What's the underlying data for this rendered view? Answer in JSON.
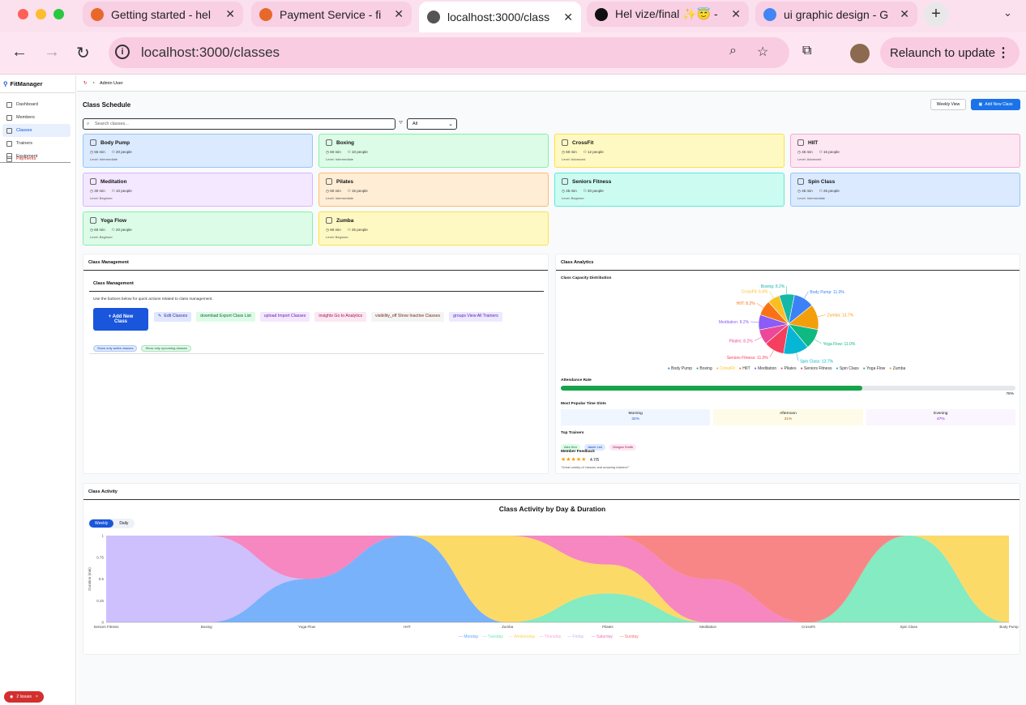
{
  "browser": {
    "tabs": [
      {
        "title": "Getting started - hel",
        "fav_color": "#e8682a"
      },
      {
        "title": "Payment Service - fi",
        "fav_color": "#e8682a"
      },
      {
        "title": "localhost:3000/class",
        "fav_color": "#555555"
      },
      {
        "title": "Hel vize/final ✨😇 -",
        "fav_color": "#111111"
      },
      {
        "title": "ui graphic design - G",
        "fav_color": "#4285f4"
      }
    ],
    "url": "localhost:3000/classes",
    "relaunch_label": "Relaunch to update"
  },
  "sidebar": {
    "brand": "FitManager",
    "items": [
      {
        "label": "Dashboard"
      },
      {
        "label": "Members"
      },
      {
        "label": "Classes"
      },
      {
        "label": "Trainers"
      },
      {
        "label": "Equipment"
      },
      {
        "label": "Payments"
      }
    ]
  },
  "topbar": {
    "user": "Admin User"
  },
  "schedule": {
    "title": "Class Schedule",
    "weekly_view": "Weekly View",
    "add_class": "Add New Class",
    "search_placeholder": "Search classes...",
    "filter_value": "All",
    "classes": [
      {
        "name": "Body Pump",
        "duration": "55 min",
        "capacity": "20 people",
        "level": "Level: Intermediate",
        "bg": "#dbeafe",
        "border": "#93c5fd"
      },
      {
        "name": "Boxing",
        "duration": "60 min",
        "capacity": "10 people",
        "level": "Level: Intermediate",
        "bg": "#dcfce7",
        "border": "#86efac"
      },
      {
        "name": "CrossFit",
        "duration": "60 min",
        "capacity": "12 people",
        "level": "Level: Advanced",
        "bg": "#fef9c3",
        "border": "#fde047"
      },
      {
        "name": "HIIT",
        "duration": "45 min",
        "capacity": "15 people",
        "level": "Level: Advanced",
        "bg": "#fce7f3",
        "border": "#f9a8d4"
      },
      {
        "name": "Meditation",
        "duration": "30 min",
        "capacity": "10 people",
        "level": "Level: Beginner",
        "bg": "#f3e8ff",
        "border": "#d8b4fe"
      },
      {
        "name": "Pilates",
        "duration": "50 min",
        "capacity": "15 people",
        "level": "Level: Intermediate",
        "bg": "#ffedd5",
        "border": "#fdba74"
      },
      {
        "name": "Seniors Fitness",
        "duration": "45 min",
        "capacity": "20 people",
        "level": "Level: Beginner",
        "bg": "#ccfbf1",
        "border": "#5eead4"
      },
      {
        "name": "Spin Class",
        "duration": "45 min",
        "capacity": "25 people",
        "level": "Level: Intermediate",
        "bg": "#dbeafe",
        "border": "#93c5fd"
      },
      {
        "name": "Yoga Flow",
        "duration": "60 min",
        "capacity": "20 people",
        "level": "Level: Beginner",
        "bg": "#dcfce7",
        "border": "#86efac"
      },
      {
        "name": "Zumba",
        "duration": "60 min",
        "capacity": "25 people",
        "level": "Level: Beginner",
        "bg": "#fef9c3",
        "border": "#fde047"
      }
    ]
  },
  "management": {
    "title": "Class Management",
    "inner_title": "Class Management",
    "description": "Use the buttons below for quick actions related to class management.",
    "add_label": "+ Add New Class",
    "actions": [
      {
        "label": "Edit Classes",
        "icon": "edit-icon",
        "bg": "#e0e7ff",
        "color": "#3730a3"
      },
      {
        "label": "download  Export Class List",
        "icon": "",
        "bg": "#dcfce7",
        "color": "#166534"
      },
      {
        "label": "upload  Import Classes",
        "icon": "",
        "bg": "#f3e8ff",
        "color": "#6b21a8"
      },
      {
        "label": "insights  Go to Analytics",
        "icon": "",
        "bg": "#fce7f3",
        "color": "#9d174d"
      },
      {
        "label": "visibility_off  Show Inactive Classes",
        "icon": "",
        "bg": "#f3f4f6",
        "color": "#7c2d12"
      },
      {
        "label": "groups  View All Trainers",
        "icon": "",
        "bg": "#ede9fe",
        "color": "#5b21b6"
      }
    ],
    "pills": [
      {
        "label": "Show only active classes",
        "bg": "#dbeafe",
        "color": "#1e40af"
      },
      {
        "label": "Show only upcoming classes",
        "bg": "#dcfce7",
        "color": "#166534"
      }
    ]
  },
  "analytics": {
    "title": "Class Analytics",
    "pie_title": "Class Capacity Distribution",
    "attendance_label": "Attendance Rate",
    "attendance_value": 0.78,
    "attendance_text": "78%",
    "timeslots_title": "Most Popular Time Slots",
    "timeslots": [
      {
        "label": "Morning",
        "value": "32%",
        "bg": "#eff6ff",
        "color": "#1d4ed8"
      },
      {
        "label": "Afternoon",
        "value": "21%",
        "bg": "#fefce8",
        "color": "#a16207"
      },
      {
        "label": "Evening",
        "value": "47%",
        "bg": "#faf5ff",
        "color": "#7e22ce"
      }
    ],
    "trainers_title": "Top Trainers",
    "trainers": [
      {
        "name": "Alex Kim",
        "bg": "#dcfce7",
        "color": "#166534"
      },
      {
        "name": "Jamie Lee",
        "bg": "#dbeafe",
        "color": "#1e40af"
      },
      {
        "name": "Morgan Smith",
        "bg": "#fce7f3",
        "color": "#9d174d"
      }
    ],
    "feedback_title": "Member Feedback",
    "stars": "★★★★★",
    "rating": "4.7/5",
    "quote": "\"Great variety of classes and amazing trainers!\""
  },
  "activity": {
    "title": "Class Activity",
    "toggle": [
      "Weekly",
      "Daily"
    ]
  },
  "chart_data": [
    {
      "type": "pie",
      "title": "Class Capacity Distribution",
      "slices": [
        {
          "label": "Body Pump",
          "value": 11.0,
          "text": "Body Pump: 11.0%",
          "color": "#3b82f6"
        },
        {
          "label": "Zumba",
          "value": 13.7,
          "text": "Zumba: 13.7%",
          "color": "#f59e0b"
        },
        {
          "label": "Yoga Flow",
          "value": 11.0,
          "text": "Yoga Flow: 11.0%",
          "color": "#10b981"
        },
        {
          "label": "Spin Class",
          "value": 13.7,
          "text": "Spin Class: 13.7%",
          "color": "#06b6d4"
        },
        {
          "label": "Seniors Fitness",
          "value": 11.0,
          "text": "Seniors Fitness: 11.0%",
          "color": "#f43f5e"
        },
        {
          "label": "Pilates",
          "value": 8.2,
          "text": "Pilates: 8.2%",
          "color": "#ec4899"
        },
        {
          "label": "Meditation",
          "value": 8.2,
          "text": "Meditation: 8.2%",
          "color": "#8b5cf6"
        },
        {
          "label": "HIIT",
          "value": 8.2,
          "text": "HIIT: 8.2%",
          "color": "#f97316"
        },
        {
          "label": "CrossFit",
          "value": 6.6,
          "text": "CrossFit: 6.6%",
          "color": "#fbbf24"
        },
        {
          "label": "Boxing",
          "value": 8.2,
          "text": "Boxing: 8.2%",
          "color": "#14b8a6"
        }
      ],
      "legend": [
        {
          "label": "Body Pump",
          "color": "#3b82f6"
        },
        {
          "label": "Boxing",
          "color": "#10b981"
        },
        {
          "label": "CrossFit",
          "color": "#fbbf24"
        },
        {
          "label": "HIIT",
          "color": "#f97316"
        },
        {
          "label": "Meditation",
          "color": "#8b5cf6"
        },
        {
          "label": "Pilates",
          "color": "#ec4899"
        },
        {
          "label": "Seniors Fitness",
          "color": "#f43f5e"
        },
        {
          "label": "Spin Class",
          "color": "#06b6d4"
        },
        {
          "label": "Yoga Flow",
          "color": "#10b981"
        },
        {
          "label": "Zumba",
          "color": "#f59e0b"
        }
      ]
    },
    {
      "type": "area",
      "title": "Class Activity by Day & Duration",
      "ylabel": "Duration (min)",
      "ylim": [
        0,
        1
      ],
      "yticks": [
        "0",
        "0.25",
        "0.5",
        "0.75",
        "1"
      ],
      "categories": [
        "Seniors Fitness",
        "Boxing",
        "Yoga Flow",
        "HIIT",
        "Zumba",
        "Pilates",
        "Meditation",
        "CrossFit",
        "Spin Class",
        "Body Pump"
      ],
      "series": [
        {
          "name": "Monday",
          "color": "#60a5fa",
          "values": [
            0,
            0,
            0.5,
            1,
            0,
            0,
            0,
            0,
            0,
            0
          ]
        },
        {
          "name": "Tuesday",
          "color": "#6ee7b7",
          "values": [
            0,
            0,
            0,
            0,
            0,
            0.5,
            0,
            0,
            1,
            0
          ]
        },
        {
          "name": "Wednesday",
          "color": "#fcd34d",
          "values": [
            0,
            0,
            0,
            0,
            1,
            0.5,
            0,
            0,
            0,
            1
          ]
        },
        {
          "name": "Thursday",
          "color": "#f9a8d4",
          "values": [
            0,
            0,
            0,
            0,
            0,
            0,
            0,
            0,
            0,
            0
          ]
        },
        {
          "name": "Friday",
          "color": "#c4b5fd",
          "values": [
            1,
            1,
            0,
            0,
            0,
            0,
            0,
            0,
            0,
            0
          ]
        },
        {
          "name": "Saturday",
          "color": "#f472b6",
          "values": [
            0,
            0,
            0.5,
            0,
            0,
            0.5,
            0.5,
            0,
            0,
            0
          ]
        },
        {
          "name": "Sunday",
          "color": "#f87171",
          "values": [
            0,
            0,
            0,
            0,
            0,
            0,
            0.5,
            1,
            0,
            0
          ]
        }
      ]
    }
  ],
  "issues_label": "2 Issues"
}
